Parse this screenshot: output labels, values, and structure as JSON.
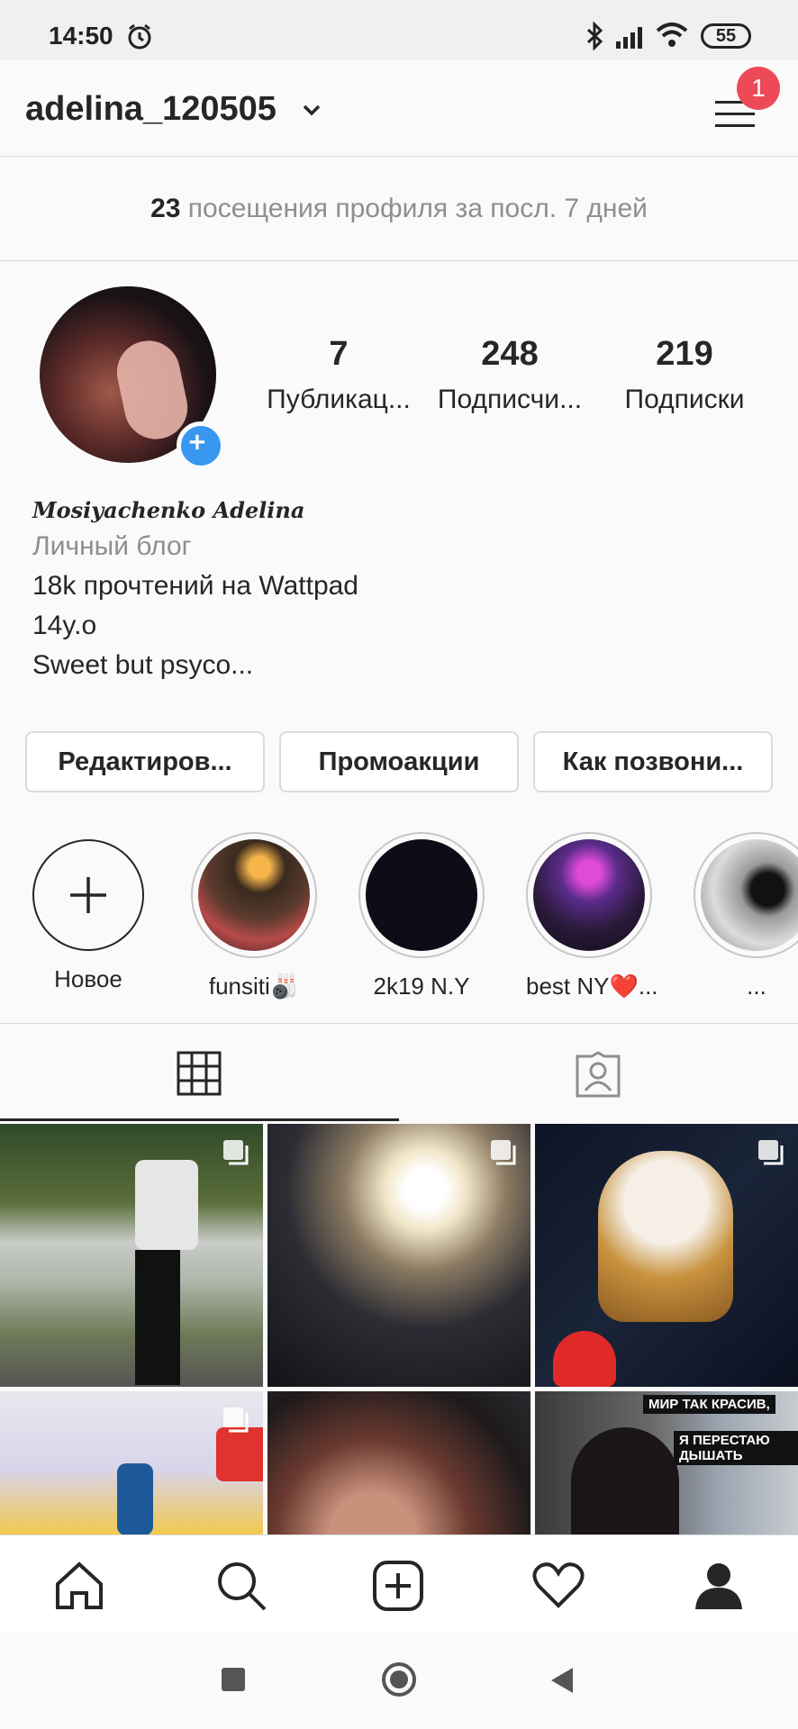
{
  "status_bar": {
    "time": "14:50",
    "battery": "55"
  },
  "header": {
    "username": "adelina_120505",
    "notification_count": "1"
  },
  "profile_visits": {
    "count": "23",
    "text": "посещения профиля за посл. 7 дней"
  },
  "stats": [
    {
      "value": "7",
      "label": "Публикац..."
    },
    {
      "value": "248",
      "label": "Подписчи..."
    },
    {
      "value": "219",
      "label": "Подписки"
    }
  ],
  "bio": {
    "full_name": "Mosiyachenko Adelina",
    "category": "Личный блог",
    "lines": [
      "18k прочтений на Wattpad",
      "14y.o",
      "Sweet but psyco..."
    ]
  },
  "actions": [
    "Редактиров...",
    "Промоакции",
    "Как позвони..."
  ],
  "highlights": [
    {
      "label": "Новое"
    },
    {
      "label": "funsiti🎳"
    },
    {
      "label": "2k19 N.Y"
    },
    {
      "label": "best NY❤️..."
    },
    {
      "label": "..."
    }
  ],
  "grid_posts": [
    {
      "overlay_text": ""
    },
    {
      "overlay_text": ""
    },
    {
      "overlay_text": ""
    },
    {
      "overlay_text": ""
    },
    {
      "overlay_text": ""
    },
    {
      "overlay_text": [
        "МИР ТАК КРАСИВ,",
        "Я ПЕРЕСТАЮ ДЫШАТЬ"
      ]
    }
  ],
  "colors": {
    "accent_blue": "#3897f0",
    "badge_red": "#ed4956",
    "text": "#262626",
    "muted": "#8e8e8e"
  },
  "icons": [
    "alarm-icon",
    "bluetooth-icon",
    "signal-icon",
    "wifi-icon",
    "battery-icon",
    "menu-icon",
    "grid-icon",
    "tagged-icon",
    "home-icon",
    "search-icon",
    "add-post-icon",
    "heart-icon",
    "profile-icon"
  ]
}
